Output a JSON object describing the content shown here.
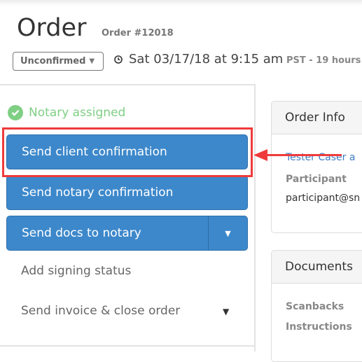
{
  "header": {
    "title": "Order",
    "order_number": "Order #12018",
    "status_select": {
      "value": "Unconfirmed",
      "icon": "caret-down-icon"
    },
    "clock_icon": "clock-icon",
    "datetime": "Sat 03/17/18 at 9:15 am",
    "timezone_note": "PST - 19 hours"
  },
  "actions": {
    "notary_status": {
      "label": "Notary assigned",
      "icon": "check-circle-icon",
      "color": "#7fcf84"
    },
    "buttons": {
      "send_client_confirmation": "Send client confirmation",
      "send_notary_confirmation": "Send notary confirmation",
      "send_docs_to_notary": "Send docs to notary"
    },
    "links": {
      "add_signing_status": "Add signing status",
      "send_invoice_close": "Send invoice & close order"
    },
    "button_color": "#3d88cb"
  },
  "annotation": {
    "highlight_color": "#ef3b3b",
    "target": "Send client confirmation"
  },
  "order_info": {
    "heading": "Order Info",
    "client_link": "Tester Caser a",
    "participant_label": "Participant",
    "participant_email": "participant@sn"
  },
  "documents": {
    "heading": "Documents",
    "items": [
      "Scanbacks",
      "Instructions"
    ]
  }
}
